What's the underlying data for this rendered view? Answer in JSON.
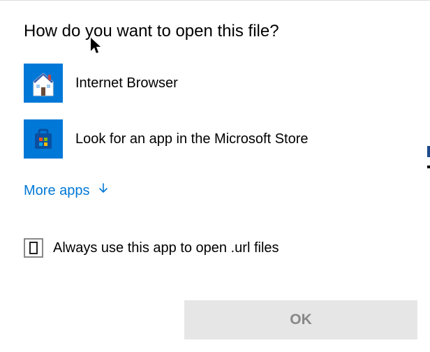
{
  "dialog": {
    "title": "How do you want to open this file?",
    "apps": [
      {
        "label": "Internet Browser"
      },
      {
        "label": "Look for an app in the Microsoft Store"
      }
    ],
    "moreApps": "More apps",
    "alwaysLabel": "Always use this app to open .url files",
    "okLabel": "OK"
  }
}
